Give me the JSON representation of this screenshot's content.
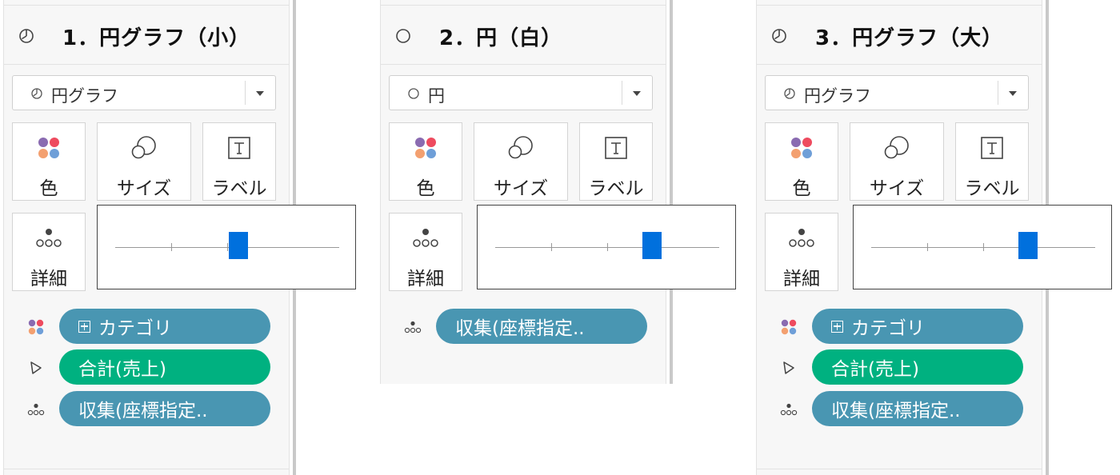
{
  "panels": [
    {
      "title": "1．円グラフ（小）",
      "mark_type_icon": "pie-chart-icon",
      "mark_type": "円グラフ",
      "cards": {
        "color": "色",
        "size": "サイズ",
        "label": "ラベル",
        "detail": "詳細"
      },
      "size_slider_value": 0.55,
      "pills": [
        {
          "icon": "color-dots-icon",
          "label": "カテゴリ",
          "style": "blue",
          "expand_icon": "plus-box-icon"
        },
        {
          "icon": "angle-icon",
          "label": "合計(売上)",
          "style": "green"
        },
        {
          "icon": "detail-dots-icon",
          "label": "収集(座標指定..",
          "style": "blue"
        }
      ]
    },
    {
      "title": "2．円（白）",
      "mark_type_icon": "circle-icon",
      "mark_type": "円",
      "cards": {
        "color": "色",
        "size": "サイズ",
        "label": "ラベル",
        "detail": "詳細"
      },
      "size_slider_value": 0.7,
      "pills": [
        {
          "icon": "detail-dots-icon",
          "label": "収集(座標指定..",
          "style": "blue"
        }
      ]
    },
    {
      "title": "3．円グラフ（大）",
      "mark_type_icon": "pie-chart-icon",
      "mark_type": "円グラフ",
      "cards": {
        "color": "色",
        "size": "サイズ",
        "label": "ラベル",
        "detail": "詳細"
      },
      "size_slider_value": 0.7,
      "pills": [
        {
          "icon": "color-dots-icon",
          "label": "カテゴリ",
          "style": "blue",
          "expand_icon": "plus-box-icon"
        },
        {
          "icon": "angle-icon",
          "label": "合計(売上)",
          "style": "green"
        },
        {
          "icon": "detail-dots-icon",
          "label": "収集(座標指定..",
          "style": "blue"
        }
      ]
    }
  ],
  "colors": {
    "pill_blue": "#4996b2",
    "pill_green": "#00b180",
    "slider_thumb": "#0070dd",
    "dot_purple": "#8a6bb1",
    "dot_red": "#ee4b5f",
    "dot_orange": "#f3a070",
    "dot_blue": "#6f9fd8"
  }
}
